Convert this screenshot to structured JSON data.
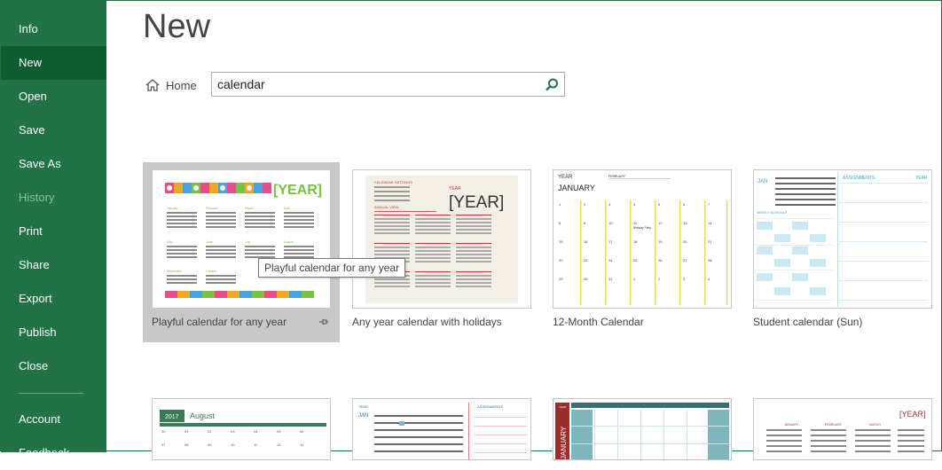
{
  "sidebar": {
    "items": [
      {
        "label": "Info",
        "state": "normal"
      },
      {
        "label": "New",
        "state": "active"
      },
      {
        "label": "Open",
        "state": "normal"
      },
      {
        "label": "Save",
        "state": "normal"
      },
      {
        "label": "Save As",
        "state": "normal"
      },
      {
        "label": "History",
        "state": "disabled"
      },
      {
        "label": "Print",
        "state": "normal"
      },
      {
        "label": "Share",
        "state": "normal"
      },
      {
        "label": "Export",
        "state": "normal"
      },
      {
        "label": "Publish",
        "state": "normal"
      },
      {
        "label": "Close",
        "state": "normal"
      }
    ],
    "bottom_items": [
      {
        "label": "Account"
      },
      {
        "label": "Feedback"
      }
    ]
  },
  "main": {
    "title": "New",
    "home_label": "Home",
    "search_value": "calendar",
    "tooltip": "Playful calendar for any year",
    "templates": [
      {
        "label": "Playful calendar for any year",
        "thumb": {
          "year": "[YEAR]",
          "months": [
            "January",
            "February",
            "March",
            "April",
            "May",
            "June",
            "July",
            "August",
            "September",
            "October",
            "November",
            "December"
          ]
        }
      },
      {
        "label": "Any year calendar with holidays",
        "thumb": {
          "settings": "CALENDAR SETTINGS",
          "year_label": "YEAR",
          "year": "[YEAR]",
          "view": "ANNUAL VIEW"
        }
      },
      {
        "label": "12-Month Calendar",
        "thumb": {
          "year": "YEAR",
          "month_small": "FEBRUARY",
          "month": "JANUARY",
          "note": "Birthday Party"
        }
      },
      {
        "label": "Student calendar (Sun)",
        "thumb": {
          "month": "JAN",
          "assignments": "ASSIGNMENTS",
          "year": "YEAR",
          "schedule": "WEEKLY SCHEDULE"
        }
      },
      {
        "label": "",
        "thumb": {
          "year": "2017",
          "month": "August"
        }
      },
      {
        "label": "",
        "thumb": {
          "year": "YEAR",
          "month": "JAN",
          "assignments": "ASSIGNMENTS"
        }
      },
      {
        "label": "",
        "thumb": {
          "year": "YEAR",
          "month": "JANUARY"
        }
      },
      {
        "label": "",
        "thumb": {
          "year": "[YEAR]",
          "months": [
            "JANUARY",
            "FEBRUARY",
            "MARCH"
          ]
        }
      }
    ]
  },
  "colors": {
    "excel_green": "#217346",
    "excel_green_dark": "#0e5c2f"
  }
}
